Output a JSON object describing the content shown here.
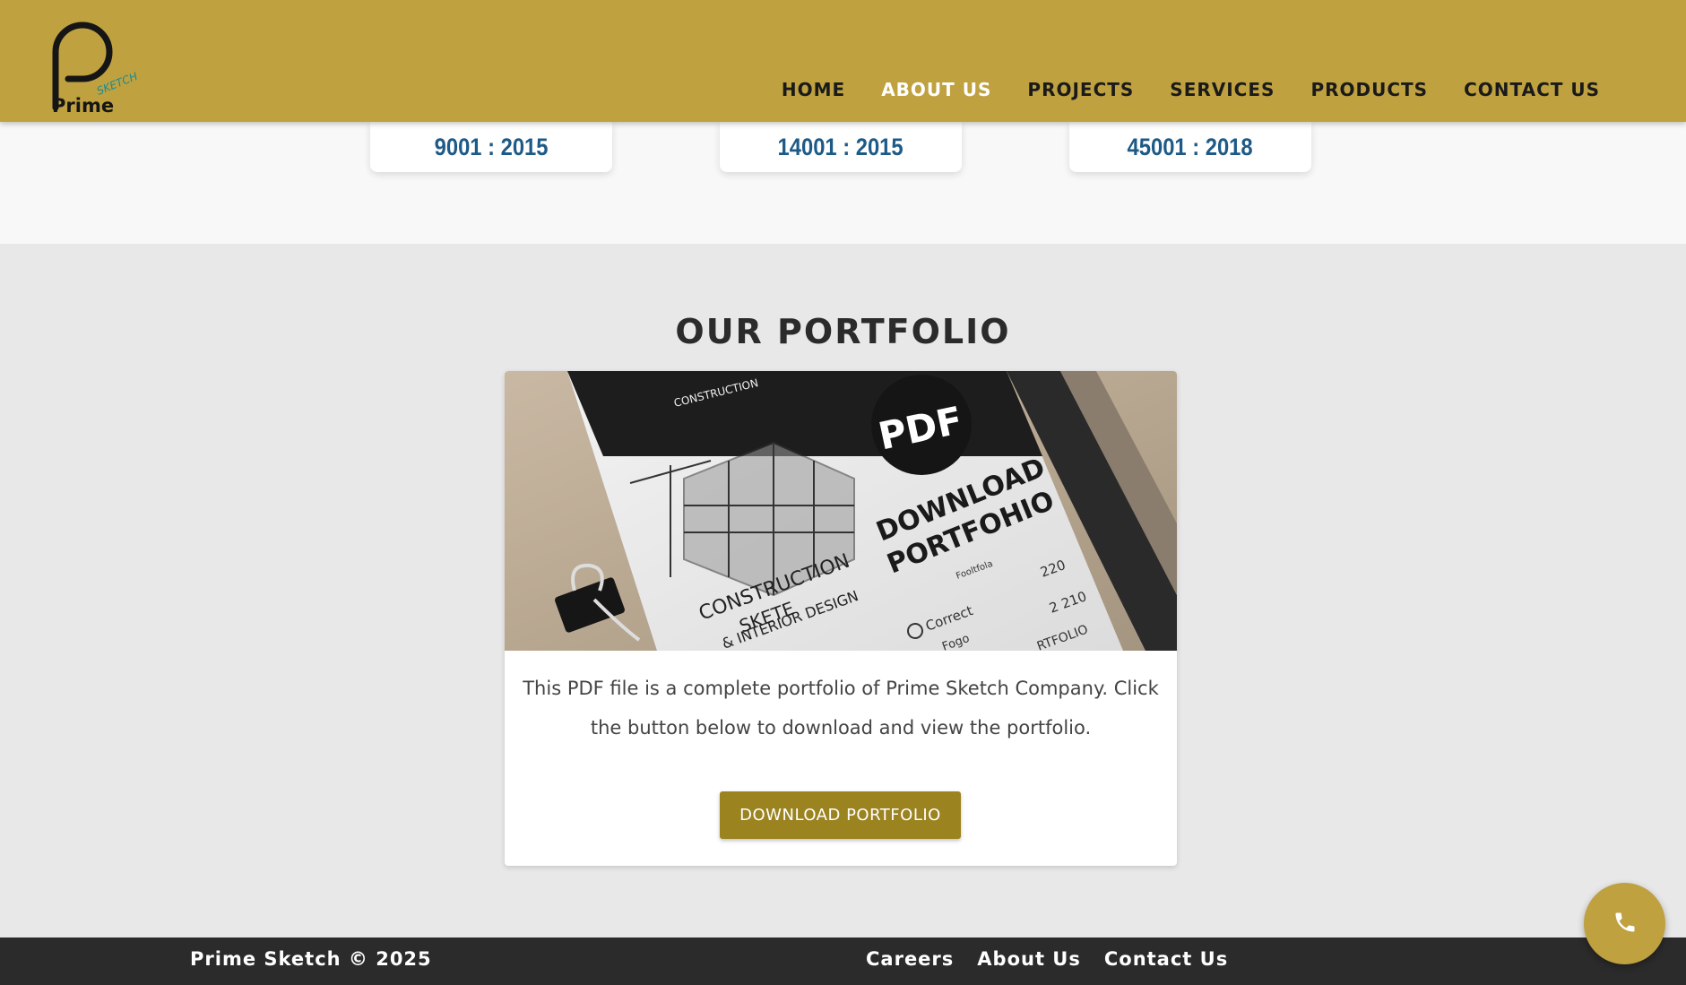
{
  "header": {
    "logo_text": "Prime",
    "logo_sub": "SKETCH",
    "nav": [
      {
        "label": "HOME",
        "active": false
      },
      {
        "label": "ABOUT US",
        "active": true
      },
      {
        "label": "PROJECTS",
        "active": false
      },
      {
        "label": "SERVICES",
        "active": false
      },
      {
        "label": "PRODUCTS",
        "active": false
      },
      {
        "label": "CONTACT US",
        "active": false
      }
    ]
  },
  "certifications": [
    "9001 : 2015",
    "14001 : 2015",
    "45001 : 2018"
  ],
  "portfolio": {
    "title": "OUR PORTFOLIO",
    "image_text": {
      "badge": "PDF",
      "heading_line1": "DOWNLOAD",
      "heading_line2": "PORTFOHIO",
      "caption_line1": "CONSTRUCTION",
      "caption_line2": "SKETE",
      "caption_line3": "& INTERIOR DESIGN",
      "brand_sub": "CONSTRUCTION",
      "row1_label": "Fooltfola",
      "row1_value": "220",
      "row2_label": "Correct",
      "row2_value": "2 210",
      "row3_label": "Fogo",
      "row3_value": "RTFOLIO"
    },
    "description": "This PDF file is a complete portfolio of Prime Sketch Company. Click the button below to download and view the portfolio.",
    "button_label": "DOWNLOAD PORTFOLIO"
  },
  "footer": {
    "copyright": "Prime Sketch © 2025",
    "links": [
      "Careers",
      "About Us",
      "Contact Us"
    ]
  },
  "colors": {
    "header_bg": "#bfa13f",
    "button_bg": "#9b8320",
    "cert_text": "#1d5a87",
    "footer_bg": "#2b2b2b"
  },
  "icons": {
    "floating_button": "phone-icon"
  }
}
